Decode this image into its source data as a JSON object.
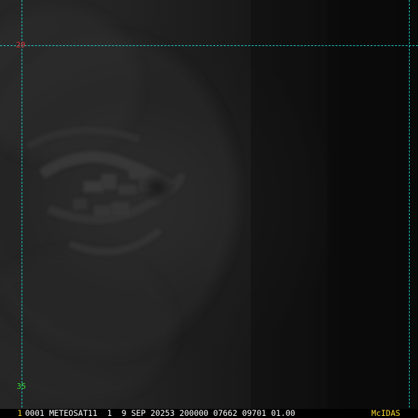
{
  "image": {
    "subject": "satellite-imagery",
    "colors": {
      "grid": "#1fd3d3",
      "lat_label_top": "#e03030",
      "lat_label_bottom": "#33dd33",
      "footer_text": "#ffffff",
      "footer_index": "#ffdd33",
      "brand": "#ffdd33"
    }
  },
  "grid": {
    "lat_top_label": "20",
    "lat_bottom_label": "35"
  },
  "footer": {
    "index": "1",
    "info": "0001 METEOSAT11  1  9 SEP 20253 200000 07662 09701 01.00",
    "brand": "McIDAS"
  }
}
